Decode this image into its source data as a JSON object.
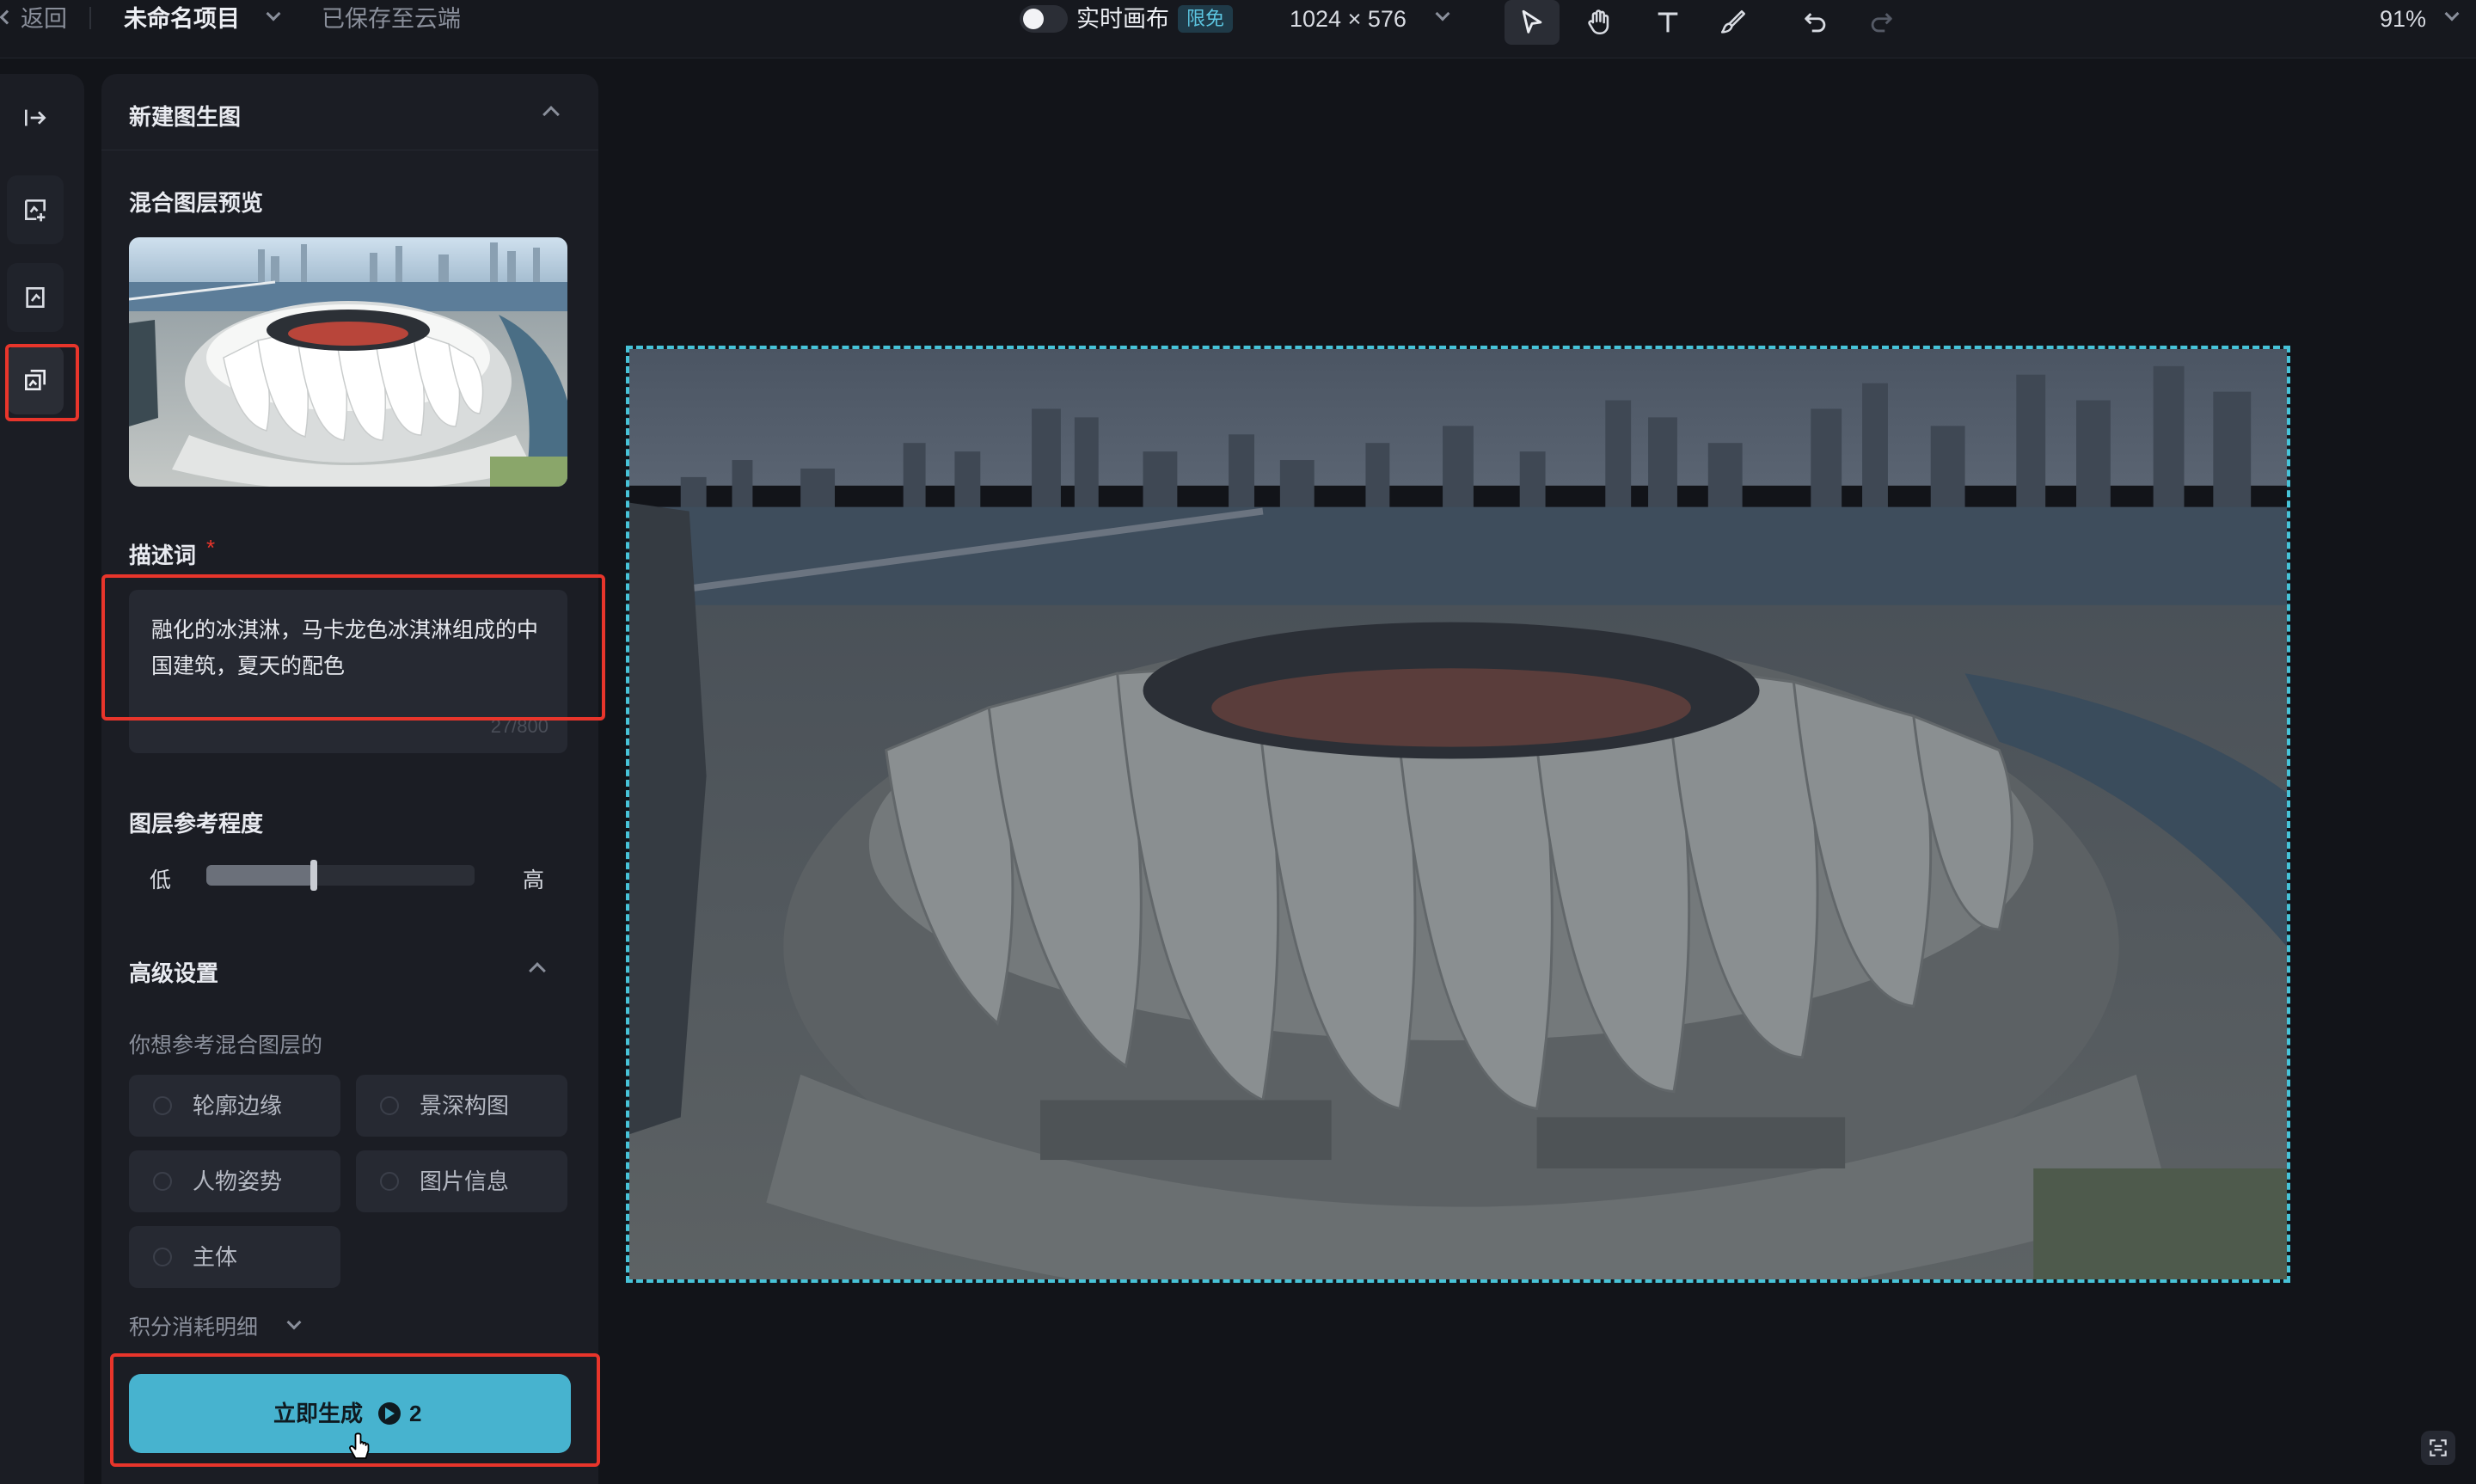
{
  "topbar": {
    "back_label": "返回",
    "project_name": "未命名项目",
    "save_status": "已保存至云端",
    "realtime_label": "实时画布",
    "realtime_badge": "限免",
    "canvas_size": "1024 × 576",
    "zoom": "91%"
  },
  "panel": {
    "title": "新建图生图",
    "preview_label": "混合图层预览",
    "prompt_label": "描述词",
    "required_mark": "*",
    "prompt_text": "融化的冰淇淋，马卡龙色冰淇淋组成的中国建筑，夏天的配色",
    "prompt_count": "27/800",
    "reference_label": "图层参考程度",
    "slider_low": "低",
    "slider_high": "高",
    "slider_value": 0.4,
    "advanced_label": "高级设置",
    "advanced_question": "你想参考混合图层的",
    "options": [
      "轮廓边缘",
      "景深构图",
      "人物姿势",
      "图片信息",
      "主体"
    ],
    "credits_detail": "积分消耗明细",
    "generate_label": "立即生成",
    "generate_cost": "2"
  },
  "icons": [
    "arrow-left-icon",
    "chevron-down-icon",
    "pointer-icon",
    "hand-icon",
    "text-icon",
    "brush-icon",
    "undo-icon",
    "redo-icon",
    "collapse-icon",
    "add-image-icon",
    "crop-icon",
    "layers-icon",
    "credit-icon",
    "chevron-up-icon",
    "fit-screen-icon"
  ],
  "colors": {
    "accent": "#47b3cf",
    "badge": "#2b8fb2",
    "highlight": "#e8352b"
  }
}
